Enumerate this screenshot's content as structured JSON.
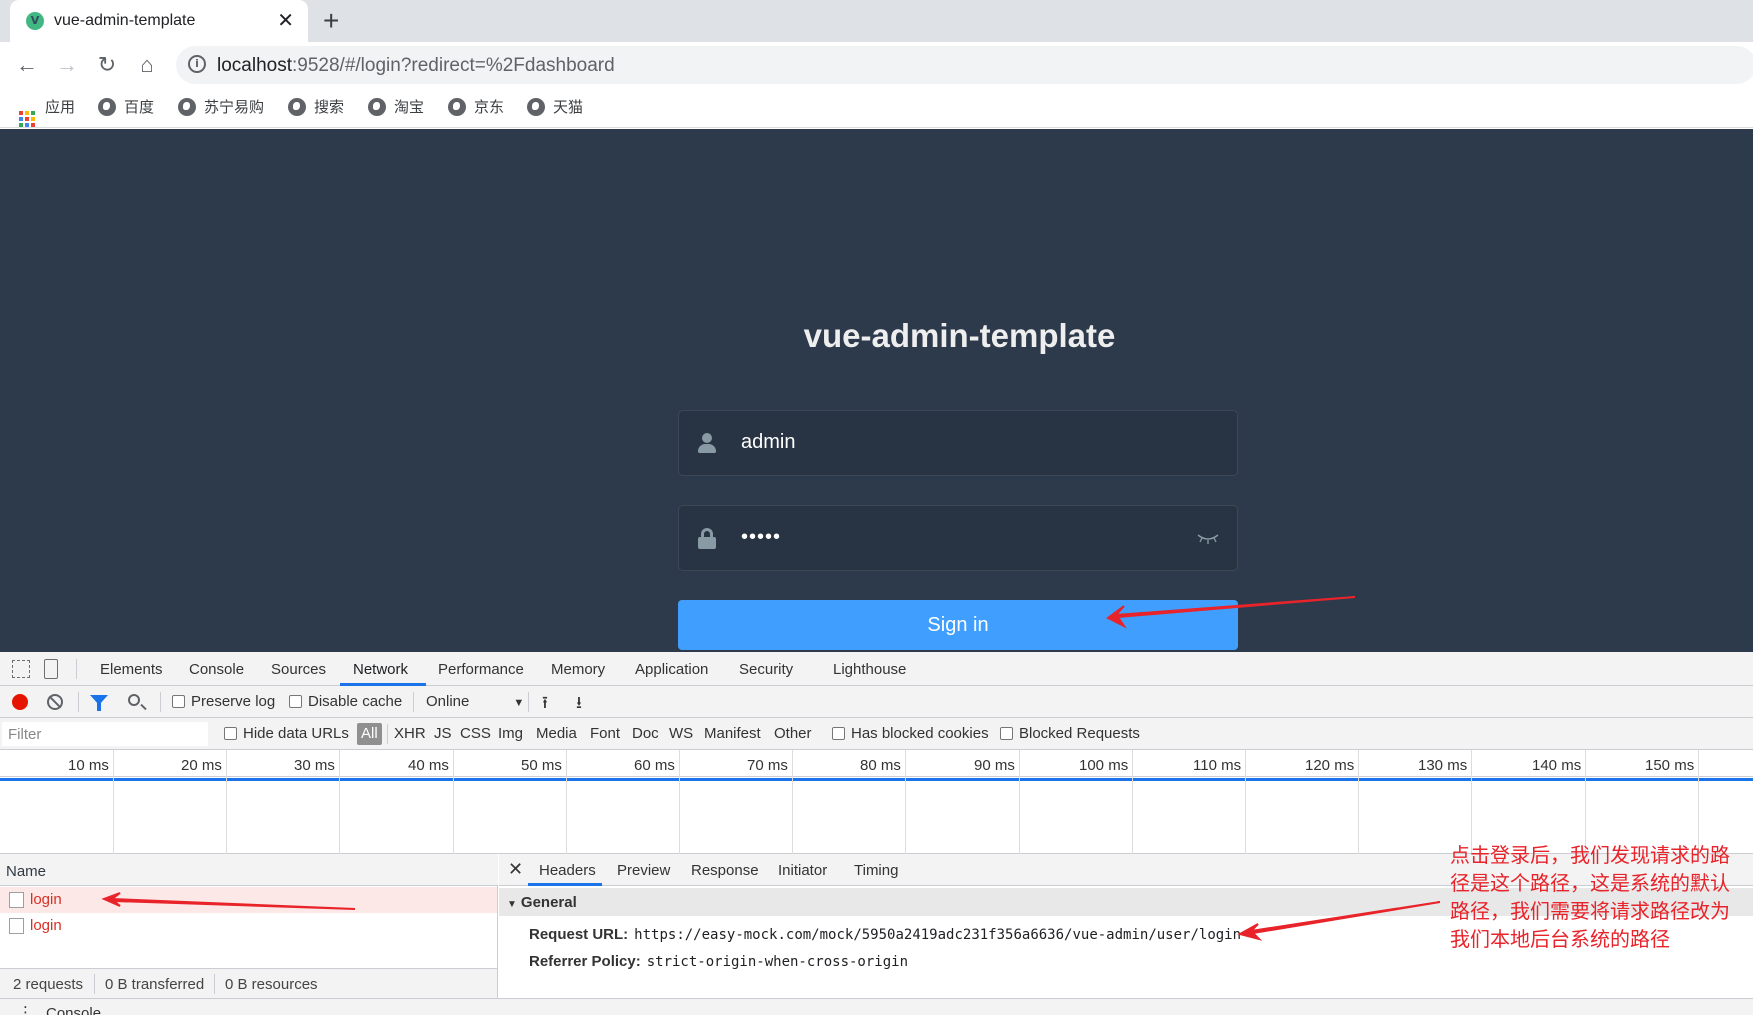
{
  "browser": {
    "tab_title": "vue-admin-template",
    "favicon_letter": "V",
    "url_host": "localhost",
    "url_rest": ":9528/#/login?redirect=%2Fdashboard",
    "bookmarks": [
      "应用",
      "百度",
      "苏宁易购",
      "搜索",
      "淘宝",
      "京东",
      "天猫"
    ]
  },
  "login": {
    "title": "vue-admin-template",
    "username": "admin",
    "password_mask": "•••••",
    "signin_label": "Sign in"
  },
  "devtools": {
    "tabs": [
      "Elements",
      "Console",
      "Sources",
      "Network",
      "Performance",
      "Memory",
      "Application",
      "Security",
      "Lighthouse"
    ],
    "active_tab": "Network",
    "controls": {
      "preserve_log": "Preserve log",
      "disable_cache": "Disable cache",
      "throttle": "Online"
    },
    "filter": {
      "placeholder": "Filter",
      "hide_data_urls": "Hide data URLs",
      "all": "All",
      "types": [
        "XHR",
        "JS",
        "CSS",
        "Img",
        "Media",
        "Font",
        "Doc",
        "WS",
        "Manifest",
        "Other"
      ],
      "has_blocked_cookies": "Has blocked cookies",
      "blocked_requests": "Blocked Requests"
    },
    "timeline_ticks": [
      "10 ms",
      "20 ms",
      "30 ms",
      "40 ms",
      "50 ms",
      "60 ms",
      "70 ms",
      "80 ms",
      "90 ms",
      "100 ms",
      "110 ms",
      "120 ms",
      "130 ms",
      "140 ms",
      "150 ms"
    ],
    "requests": {
      "column": "Name",
      "rows": [
        "login",
        "login"
      ],
      "summary": [
        "2 requests",
        "0 B transferred",
        "0 B resources"
      ]
    },
    "detail": {
      "tabs": [
        "Headers",
        "Preview",
        "Response",
        "Initiator",
        "Timing"
      ],
      "section": "General",
      "request_url_key": "Request URL:",
      "request_url": "https://easy-mock.com/mock/5950a2419adc231f356a6636/vue-admin/user/login",
      "referrer_key": "Referrer Policy:",
      "referrer": "strict-origin-when-cross-origin"
    },
    "drawer_label": "Console"
  },
  "annotation": {
    "text": "点击登录后，我们发现请求的路径是这个路径，这是系统的默认路径，我们需要将请求路径改为我们本地后台系统的路径",
    "color": "#e8232a"
  }
}
